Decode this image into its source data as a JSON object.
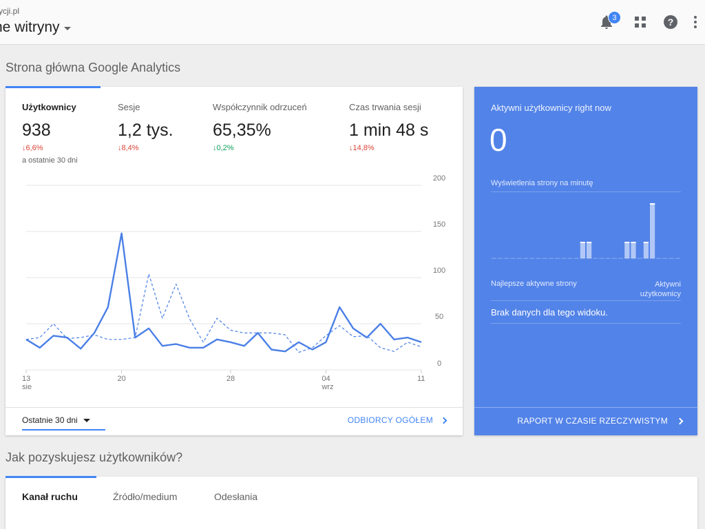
{
  "header": {
    "account": "ycji.pl",
    "view": "ne witryny",
    "notification_count": "3",
    "icons": [
      "bell-icon",
      "apps-grid-icon",
      "help-icon",
      "more-vert-icon"
    ]
  },
  "home_title": "Strona główna Google Analytics",
  "metrics": [
    {
      "label": "Użytkownicy",
      "value": "938",
      "change": "6,6%",
      "direction": "down",
      "sub": "a ostatnie 30 dni"
    },
    {
      "label": "Sesje",
      "value": "1,2 tys.",
      "change": "8,4%",
      "direction": "down"
    },
    {
      "label": "Współczynnik odrzuceń",
      "value": "65,35%",
      "change": "0,2%",
      "direction": "down-good"
    },
    {
      "label": "Czas trwania sesji",
      "value": "1 min 48 s",
      "change": "14,8%",
      "direction": "down"
    }
  ],
  "chart_data": {
    "type": "line",
    "ylim": [
      0,
      200
    ],
    "y_ticks": [
      "200",
      "150",
      "100",
      "50",
      "0"
    ],
    "x_ticks": [
      {
        "label": "13",
        "sub": "sie",
        "index": 0
      },
      {
        "label": "20",
        "sub": "",
        "index": 7
      },
      {
        "label": "28",
        "sub": "",
        "index": 15
      },
      {
        "label": "04",
        "sub": "wrz",
        "index": 22
      },
      {
        "label": "11",
        "sub": "",
        "index": 29
      }
    ],
    "series": [
      {
        "values": [
          33,
          24,
          37,
          35,
          23,
          40,
          68,
          148,
          35,
          45,
          26,
          28,
          24,
          24,
          33,
          30,
          26,
          40,
          22,
          20,
          30,
          22,
          30,
          68,
          45,
          35,
          50,
          33,
          35,
          30
        ]
      },
      {
        "values": [
          33,
          35,
          50,
          34,
          35,
          38,
          33,
          33,
          35,
          104,
          56,
          93,
          55,
          30,
          56,
          43,
          40,
          40,
          40,
          38,
          19,
          24,
          37,
          48,
          36,
          37,
          24,
          20,
          30,
          25
        ],
        "style": "dashed"
      }
    ],
    "colors": {
      "primary": "#4a7fe6",
      "secondary": "#4a7fe6"
    }
  },
  "footer": {
    "date_range": "Ostatnie 30 dni",
    "audience_link": "ODBIORCY OGÓŁEM"
  },
  "realtime": {
    "title": "Aktywni użytkownicy right now",
    "value": "0",
    "pageviews_label": "Wyświetlenia strony na minutę",
    "pageviews_per_minute": [
      0,
      0,
      0,
      0,
      0,
      0,
      0,
      0,
      0,
      0,
      0,
      0,
      0,
      0,
      3,
      3,
      0,
      0,
      0,
      0,
      0,
      3,
      3,
      0,
      3,
      10,
      0,
      0,
      0,
      0
    ],
    "top_pages_label": "Najlepsze aktywne strony",
    "active_users_label_line1": "Aktywni",
    "active_users_label_line2": "użytkownicy",
    "no_data": "Brak danych dla tego widoku.",
    "report_link": "RAPORT W CZASIE RZECZYWISTYM"
  },
  "acquisition": {
    "title": "Jak pozyskujesz użytkowników?",
    "tabs": [
      "Kanał ruchu",
      "Źródło/medium",
      "Odesłania"
    ]
  },
  "colors": {
    "accent": "#4285f4",
    "realtime_bg": "#5283e8",
    "negative": "#db4437",
    "positive": "#0f9d58"
  }
}
